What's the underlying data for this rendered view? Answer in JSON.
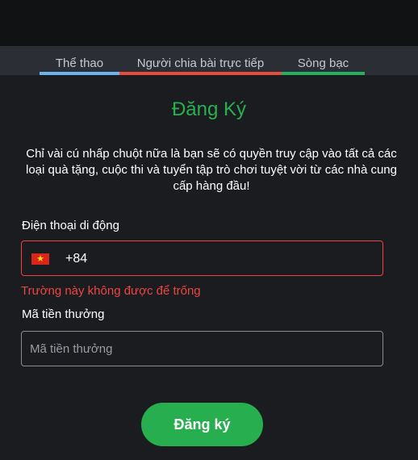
{
  "tabs": [
    {
      "label": "Thể thao",
      "color": "#6cb4ee"
    },
    {
      "label": "Người chia bài trực tiếp",
      "color": "#e74c3c"
    },
    {
      "label": "Sòng bạc",
      "color": "#27ae60"
    }
  ],
  "form": {
    "title": "Đăng Ký",
    "description": "Chỉ vài cú nhấp chuột nữa là bạn sẽ có quyền truy cập vào tất cả các loại quà tặng, cuộc thi và tuyển tập trò chơi tuyệt vời từ các nhà cung cấp hàng đầu!",
    "phone": {
      "label": "Điện thoại di động",
      "flag_icon": "vietnam-flag-icon",
      "code": "+84",
      "error": "Trường này không được để trống"
    },
    "bonus": {
      "label": "Mã tiền thưởng",
      "placeholder": "Mã tiền thưởng"
    },
    "submit_label": "Đăng ký"
  },
  "colors": {
    "accent": "#27ae4f",
    "error": "#ef4444",
    "background": "#1b1c20"
  }
}
